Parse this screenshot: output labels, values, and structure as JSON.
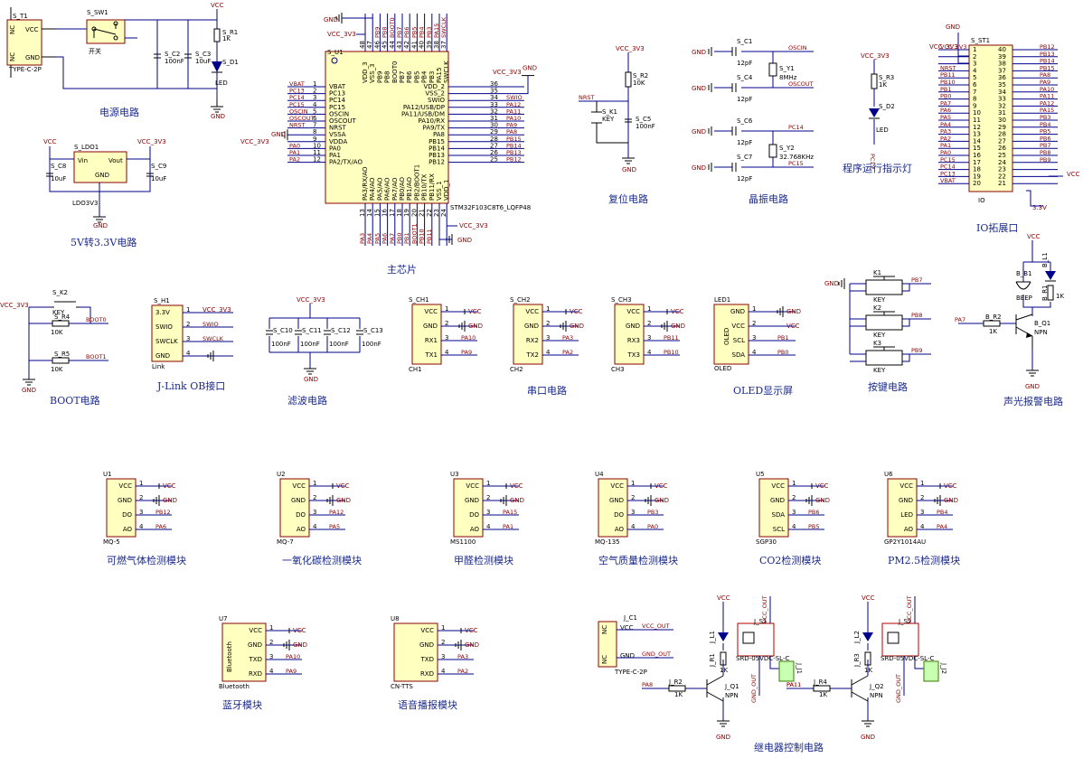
{
  "titles": {
    "power": "电源电路",
    "ldo": "5V转3.3V电路",
    "mcu": "主芯片",
    "reset": "复位电路",
    "crystal": "晶振电路",
    "led": "程序运行指示灯",
    "io": "IO拓展口",
    "boot": "BOOT电路",
    "jlink": "J-Link OB接口",
    "filter": "滤波电路",
    "uart": "串口电路",
    "oled": "OLED显示屏",
    "keys": "按键电路",
    "alarm": "声光报警电路",
    "mq5": "可燃气体检测模块",
    "mq7": "一氧化碳检测模块",
    "ms1100": "甲醛检测模块",
    "mq135": "空气质量检测模块",
    "co2": "CO2检测模块",
    "pm25": "PM2.5检测模块",
    "bt": "蓝牙模块",
    "tts": "语音播报模块",
    "relay": "继电器控制电路"
  },
  "power": {
    "usb_ref": "S_T1",
    "usb_part": "TYPE-C-2P",
    "usb_nc": "NC",
    "usb_vcc": "VCC",
    "usb_gnd": "GND",
    "usb_nc2": "NC",
    "sw_ref": "S_SW1",
    "sw_label": "开关",
    "c2": "S_C2",
    "c2v": "100nF",
    "c3": "S_C3",
    "c3v": "10uF",
    "r1": "S_R1",
    "r1v": "1K",
    "d1": "S_D1",
    "d1v": "LED",
    "vcc": "VCC",
    "gnd": "GND"
  },
  "ldo": {
    "ref": "S_LDO1",
    "part": "LDO3V3",
    "vin": "Vin",
    "vout": "Vout",
    "gndpin": "GND",
    "c8": "S_C8",
    "c8v": "10uF",
    "c9": "S_C9",
    "c9v": "10uF",
    "vcc": "VCC",
    "vcc33": "VCC_3V3",
    "gnd": "GND"
  },
  "mcu": {
    "ref": "S_U1",
    "part": "STM32F103C8T6_LQFP48",
    "left_pins": [
      {
        "num": "1",
        "name": "VBAT",
        "net": "VBAT"
      },
      {
        "num": "2",
        "name": "PC13",
        "net": "PC13"
      },
      {
        "num": "3",
        "name": "PC14",
        "net": "PC14"
      },
      {
        "num": "4",
        "name": "PC15",
        "net": "PC15"
      },
      {
        "num": "5",
        "name": "OSCIN",
        "net": "OSCIN"
      },
      {
        "num": "6",
        "name": "OSCOUT",
        "net": "OSCOUT"
      },
      {
        "num": "7",
        "name": "NRST",
        "net": "NRST"
      },
      {
        "num": "8",
        "name": "VSSA",
        "net": "GND"
      },
      {
        "num": "9",
        "name": "VDDA",
        "net": "VCC_3V3"
      },
      {
        "num": "10",
        "name": "PA0",
        "net": "PA0"
      },
      {
        "num": "11",
        "name": "PA1",
        "net": "PA1"
      },
      {
        "num": "12",
        "name": "PA2/TX/AO",
        "net": "PA2"
      }
    ],
    "right_pins": [
      {
        "num": "36",
        "name": "VDD_2",
        "net": "VCC_3V3"
      },
      {
        "num": "35",
        "name": "VSS_2",
        "net": "GND"
      },
      {
        "num": "34",
        "name": "SWIO",
        "net": "SWIO"
      },
      {
        "num": "33",
        "name": "PA12/USB/DP",
        "net": "PA12"
      },
      {
        "num": "32",
        "name": "PA11/USB/DM",
        "net": "PA11"
      },
      {
        "num": "31",
        "name": "PA10/RX",
        "net": "PA10"
      },
      {
        "num": "30",
        "name": "PA9/TX",
        "net": "PA9"
      },
      {
        "num": "29",
        "name": "PA8",
        "net": "PA8"
      },
      {
        "num": "28",
        "name": "PB15",
        "net": "PB15"
      },
      {
        "num": "27",
        "name": "PB14",
        "net": "PB14"
      },
      {
        "num": "26",
        "name": "PB13",
        "net": "PB13"
      },
      {
        "num": "25",
        "name": "PB12",
        "net": "PB12"
      }
    ],
    "top_pins": [
      {
        "num": "48",
        "name": "VDD_3",
        "net": "VCC_3V3"
      },
      {
        "num": "47",
        "name": "VSS_3",
        "net": "GND"
      },
      {
        "num": "46",
        "name": "PB9",
        "net": "PB9"
      },
      {
        "num": "45",
        "name": "PB8",
        "net": "PB8"
      },
      {
        "num": "44",
        "name": "BOOT0",
        "net": "BOOT0"
      },
      {
        "num": "43",
        "name": "PB7",
        "net": "PB7"
      },
      {
        "num": "42",
        "name": "PB6",
        "net": "PB6"
      },
      {
        "num": "41",
        "name": "PB5",
        "net": "PB5"
      },
      {
        "num": "40",
        "name": "PB4",
        "net": "PB4"
      },
      {
        "num": "39",
        "name": "PB3",
        "net": "PB3"
      },
      {
        "num": "38",
        "name": "PA15",
        "net": "PA15"
      },
      {
        "num": "37",
        "name": "SWCLK",
        "net": "SWCLK"
      }
    ],
    "bottom_pins": [
      {
        "num": "13",
        "name": "PA3/RX/AO",
        "net": "PA3"
      },
      {
        "num": "14",
        "name": "PA4/AO",
        "net": "PA4"
      },
      {
        "num": "15",
        "name": "PA5/AO",
        "net": "PA5"
      },
      {
        "num": "16",
        "name": "PA6/AO",
        "net": "PA6"
      },
      {
        "num": "17",
        "name": "PA7/AO",
        "net": "PA7"
      },
      {
        "num": "18",
        "name": "PB0/AO",
        "net": "PB0"
      },
      {
        "num": "19",
        "name": "PB1/AO",
        "net": "PB1"
      },
      {
        "num": "20",
        "name": "PB2/BOOT1",
        "net": "BOOT1"
      },
      {
        "num": "21",
        "name": "PB10/TX",
        "net": "PB10"
      },
      {
        "num": "22",
        "name": "PB11/RX",
        "net": "PB11"
      },
      {
        "num": "23",
        "name": "VSS_1",
        "net": "GND"
      },
      {
        "num": "24",
        "name": "VDD_1",
        "net": "VCC_3V3"
      }
    ],
    "gnd": "GND",
    "vcc33": "VCC_3V3"
  },
  "reset": {
    "vcc33": "VCC_3V3",
    "r2": "S_R2",
    "r2v": "10K",
    "k1": "S_K1",
    "k1v": "KEY",
    "c5": "S_C5",
    "c5v": "100nF",
    "nrst": "NRST",
    "gnd": "GND"
  },
  "crystal": {
    "c1": "S_C1",
    "c4": "S_C4",
    "c6": "S_C6",
    "c7": "S_C7",
    "cv": "12pF",
    "y1": "S_Y1",
    "y1v": "8MHz",
    "y2": "S_Y2",
    "y2v": "32.768KHz",
    "oscin": "OSCIN",
    "oscout": "OSCOUT",
    "pc14": "PC14",
    "pc15": "PC15",
    "gnd": "GND"
  },
  "led": {
    "vcc33": "VCC_3V3",
    "r3": "S_R3",
    "r3v": "1K",
    "d2": "S_D2",
    "d2v": "LED",
    "net": "PC13"
  },
  "io": {
    "ref": "S_ST1",
    "vcc33": "VCC_3V3",
    "gnd": "GND",
    "part": "IO",
    "v33": "3.3V",
    "vcc": "VCC",
    "left": [
      {
        "num": "1",
        "net": "VCC_3V3"
      },
      {
        "num": "2",
        "net": ""
      },
      {
        "num": "3",
        "net": ""
      },
      {
        "num": "4",
        "net": "NRST"
      },
      {
        "num": "5",
        "net": "PB11"
      },
      {
        "num": "6",
        "net": "PB10"
      },
      {
        "num": "7",
        "net": "PB1"
      },
      {
        "num": "8",
        "net": "PB0"
      },
      {
        "num": "9",
        "net": "PA7"
      },
      {
        "num": "10",
        "net": "PA6"
      },
      {
        "num": "11",
        "net": "PA5"
      },
      {
        "num": "12",
        "net": "PA4"
      },
      {
        "num": "13",
        "net": "PA3"
      },
      {
        "num": "14",
        "net": "PA2"
      },
      {
        "num": "15",
        "net": "PA1"
      },
      {
        "num": "16",
        "net": "PA0"
      },
      {
        "num": "17",
        "net": "PC15"
      },
      {
        "num": "18",
        "net": "PC14"
      },
      {
        "num": "19",
        "net": "PC13"
      },
      {
        "num": "20",
        "net": "VBAT"
      }
    ],
    "right": [
      {
        "num": "40",
        "net": "PB12"
      },
      {
        "num": "39",
        "net": "PB13"
      },
      {
        "num": "38",
        "net": "PB14"
      },
      {
        "num": "37",
        "net": "PB15"
      },
      {
        "num": "36",
        "net": "PA8"
      },
      {
        "num": "35",
        "net": "PA9"
      },
      {
        "num": "34",
        "net": "PA10"
      },
      {
        "num": "33",
        "net": "PA11"
      },
      {
        "num": "32",
        "net": "PA12"
      },
      {
        "num": "31",
        "net": "PA15"
      },
      {
        "num": "30",
        "net": "PB3"
      },
      {
        "num": "29",
        "net": "PB4"
      },
      {
        "num": "28",
        "net": "PB5"
      },
      {
        "num": "27",
        "net": "PB6"
      },
      {
        "num": "26",
        "net": "PB7"
      },
      {
        "num": "25",
        "net": "PB8"
      },
      {
        "num": "24",
        "net": "PB9"
      },
      {
        "num": "23",
        "net": ""
      },
      {
        "num": "22",
        "net": "VCC"
      },
      {
        "num": "21",
        "net": ""
      }
    ]
  },
  "boot": {
    "vcc33": "VCC_3V3",
    "k2": "S_K2",
    "k2v": "KEY",
    "r4": "S_R4",
    "r4v": "10K",
    "r5": "S_R5",
    "r5v": "10K",
    "boot0": "BOOT0",
    "boot1": "BOOT1",
    "gnd": "GND"
  },
  "jlink": {
    "ref": "S_H1",
    "part": "Link",
    "pins": [
      {
        "num": "1",
        "name": "3.3V",
        "net": "VCC_3V3"
      },
      {
        "num": "2",
        "name": "SWIO",
        "net": "SWIO"
      },
      {
        "num": "3",
        "name": "SWCLK",
        "net": "SWCLK"
      },
      {
        "num": "4",
        "name": "GND",
        "net": ""
      }
    ]
  },
  "filter": {
    "vcc33": "VCC_3V3",
    "gnd": "GND",
    "caps": [
      {
        "ref": "S_C10",
        "val": "100nF"
      },
      {
        "ref": "S_C11",
        "val": "100nF"
      },
      {
        "ref": "S_C12",
        "val": "100nF"
      },
      {
        "ref": "S_C13",
        "val": "100nF"
      }
    ]
  },
  "uart": {
    "gnd": "GND",
    "vcc": "VCC",
    "parts": [
      {
        "ref": "S_CH1",
        "part": "CH1",
        "rx": "RX1",
        "tx": "TX1",
        "rxnet": "PA10",
        "txnet": "PA9"
      },
      {
        "ref": "S_CH2",
        "part": "CH2",
        "rx": "RX2",
        "tx": "TX2",
        "rxnet": "PA3",
        "txnet": "PA2"
      },
      {
        "ref": "S_CH3",
        "part": "CH3",
        "rx": "RX3",
        "tx": "TX3",
        "rxnet": "PB11",
        "txnet": "PB10"
      }
    ],
    "pin_vcc": "VCC",
    "pin_gnd": "GND"
  },
  "oled": {
    "ref": "LED1",
    "part": "OLED",
    "body": "OLED",
    "pins": [
      {
        "num": "1",
        "name": "GND",
        "net": "GND"
      },
      {
        "num": "2",
        "name": "VCC",
        "net": "VCC"
      },
      {
        "num": "3",
        "name": "SCL",
        "net": "PB1"
      },
      {
        "num": "4",
        "name": "SDA",
        "net": "PB0"
      }
    ]
  },
  "keys": {
    "gnd": "GND",
    "items": [
      {
        "ref": "K1",
        "val": "KEY",
        "net": "PB7"
      },
      {
        "ref": "K2",
        "val": "KEY",
        "net": "PB8"
      },
      {
        "ref": "K3",
        "val": "KEY",
        "net": "PB9"
      }
    ]
  },
  "alarm": {
    "vcc": "VCC",
    "b1": "B_B1",
    "b1v": "BEEP",
    "l1": "B_L1",
    "r1": "B_R1",
    "r1v": "1K",
    "r2": "B_R2",
    "r2v": "1K",
    "q1": "B_Q1",
    "q1v": "NPN",
    "net": "PA7",
    "gnd": "GND"
  },
  "sensors": [
    {
      "ref": "U1",
      "part": "MQ-5",
      "pins": [
        "VCC",
        "GND",
        "DO",
        "AO"
      ],
      "nets": [
        "VCC",
        "GND",
        "PB12",
        "PA6"
      ]
    },
    {
      "ref": "U2",
      "part": "MQ-7",
      "pins": [
        "VCC",
        "GND",
        "DO",
        "AO"
      ],
      "nets": [
        "VCC",
        "GND",
        "PA12",
        "PA5"
      ]
    },
    {
      "ref": "U3",
      "part": "MS1100",
      "pins": [
        "VCC",
        "GND",
        "DO",
        "AO"
      ],
      "nets": [
        "VCC",
        "GND",
        "PA15",
        "PA1"
      ]
    },
    {
      "ref": "U4",
      "part": "MQ-135",
      "pins": [
        "VCC",
        "GND",
        "DO",
        "AO"
      ],
      "nets": [
        "VCC",
        "GND",
        "PB3",
        "PA0"
      ]
    },
    {
      "ref": "U5",
      "part": "SGP30",
      "pins": [
        "VCC",
        "GND",
        "SDA",
        "SCL"
      ],
      "nets": [
        "VCC",
        "GND",
        "PB6",
        "PB5"
      ]
    },
    {
      "ref": "U6",
      "part": "GP2Y1014AU",
      "pins": [
        "VCC",
        "GND",
        "LED",
        "AO"
      ],
      "nets": [
        "VCC",
        "GND",
        "PB4",
        "PA4"
      ]
    }
  ],
  "modules": [
    {
      "ref": "U7",
      "part": "Bluetooth",
      "body": "Bluetooth",
      "pins": [
        "VCC",
        "GND",
        "TXD",
        "RXD"
      ],
      "nets": [
        "VCC",
        "GND",
        "PA10",
        "PA9"
      ]
    },
    {
      "ref": "U8",
      "part": "CN-TTS",
      "body": "",
      "pins": [
        "VCC",
        "GND",
        "TXD",
        "RXD"
      ],
      "nets": [
        "VCC",
        "GND",
        "PA3",
        "PA2"
      ]
    }
  ],
  "relay": {
    "jc1": "J_C1",
    "jc1part": "TYPE-C-2P",
    "vccout": "VCC_OUT",
    "gndout": "GND_OUT",
    "vcc": "VCC",
    "nc": "NC",
    "pvcc": "VCC",
    "pgnd": "GND",
    "ch": [
      {
        "l": "J_L1",
        "r1": "J_R1",
        "r1v": "1K",
        "r2": "J_R2",
        "r2v": "1K",
        "q": "J_Q1",
        "qv": "NPN",
        "s": "J_S1",
        "relay": "SRD-05VDC-SL-C",
        "j": "J_J1",
        "net": "PA8",
        "out": "PA11"
      },
      {
        "l": "J_L2",
        "r1": "J_R3",
        "r1v": "1K",
        "r2": "J_R4",
        "r2v": "1K",
        "q": "J_Q2",
        "qv": "NPN",
        "s": "J_S2",
        "relay": "SRD-05VDC-SL-C",
        "j": "J_J2",
        "net": "PA11",
        "out": ""
      }
    ]
  }
}
